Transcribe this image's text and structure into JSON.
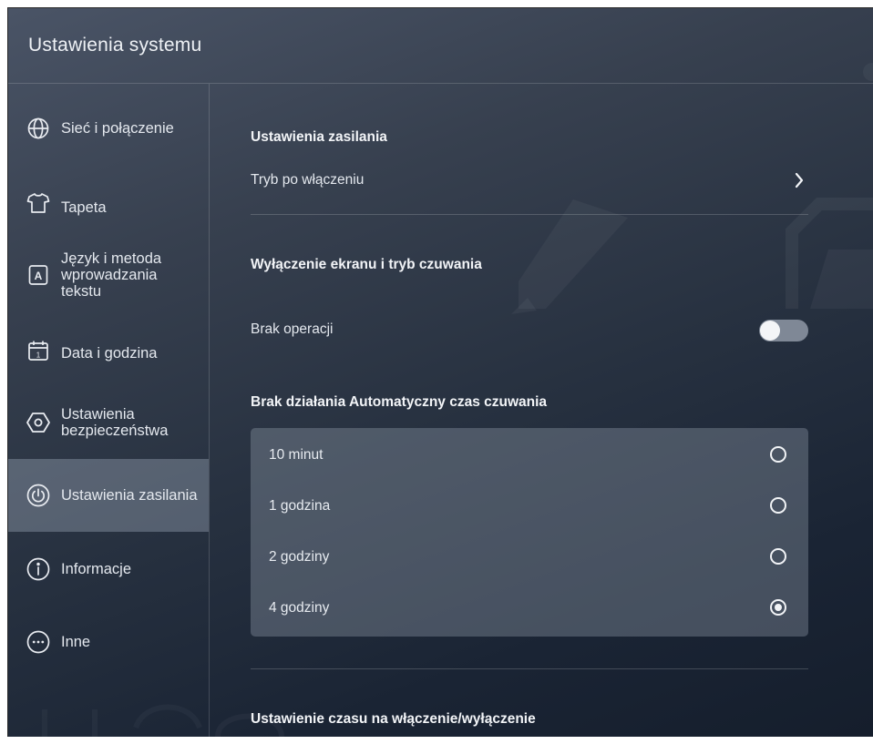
{
  "window": {
    "title": "Ustawienia systemu"
  },
  "sidebar": {
    "items": [
      {
        "label": "Sieć i połączenie",
        "icon": "globe-icon",
        "active": false
      },
      {
        "label": "Tapeta",
        "icon": "shirt-icon",
        "active": false
      },
      {
        "label": "Język i metoda wprowadzania tekstu",
        "icon": "keyboard-a-icon",
        "active": false
      },
      {
        "label": "Data i godzina",
        "icon": "calendar-icon",
        "active": false
      },
      {
        "label": "Ustawienia bezpieczeństwa",
        "icon": "hexagon-shield-icon",
        "active": false
      },
      {
        "label": "Ustawienia zasilania",
        "icon": "power-icon",
        "active": true
      },
      {
        "label": "Informacje",
        "icon": "info-icon",
        "active": false
      },
      {
        "label": "Inne",
        "icon": "more-icon",
        "active": false
      }
    ]
  },
  "main": {
    "power_section_title": "Ustawienia zasilania",
    "boot_mode_label": "Tryb po włączeniu",
    "screen_section_title": "Wyłączenie ekranu i tryb czuwania",
    "no_operation_label": "Brak operacji",
    "no_operation_enabled": false,
    "standby_section_title": "Brak działania Automatyczny czas czuwania",
    "standby_options": [
      {
        "label": "10 minut",
        "selected": false
      },
      {
        "label": "1 godzina",
        "selected": false
      },
      {
        "label": "2 godziny",
        "selected": false
      },
      {
        "label": "4 godziny",
        "selected": true
      }
    ],
    "schedule_section_title": "Ustawienie czasu na włączenie/wyłączenie"
  },
  "colors": {
    "background_top": "#4a5466",
    "background_bottom": "#151e2c",
    "active_item": "#7d8796",
    "text": "#e4e8ee"
  }
}
